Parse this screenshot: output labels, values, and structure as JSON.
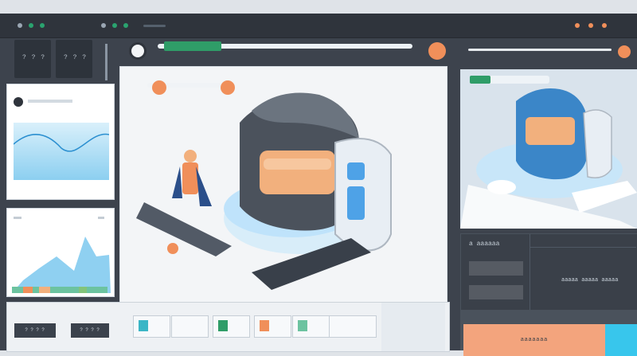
{
  "window": {
    "title_dots": [
      "gray",
      "green",
      "green"
    ],
    "right_dots": [
      "orange",
      "orange",
      "orange"
    ]
  },
  "left_sidebar": {
    "tile_labels": [
      "? ? ?",
      "? ? ?"
    ]
  },
  "canvas": {
    "toolbar_title": ""
  },
  "bottom_bar": {
    "button_1": "? ? ? ?",
    "button_2": "? ? ? ?"
  },
  "right_panel": {
    "lower_title": "a aaaaaa",
    "lower_caption": "aaaaa aaaaa aaaaa",
    "cta_label": "aaaaaaa"
  },
  "colors": {
    "accent_green": "#2f9d68",
    "accent_orange": "#f08f5a",
    "accent_blue": "#4ea2e7",
    "dark": "#3d434d"
  }
}
